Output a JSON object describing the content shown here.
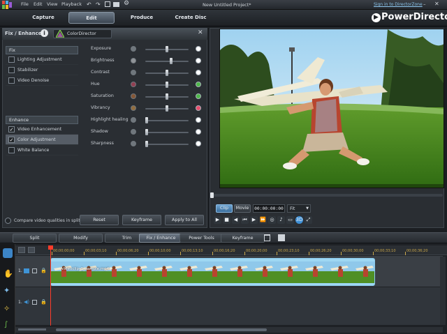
{
  "app": {
    "title": "New Untitled Project*",
    "brand": "PowerDirector",
    "link": "Sign in to DirectorZone"
  },
  "menu": [
    "File",
    "Edit",
    "View",
    "Playback"
  ],
  "main_tabs": [
    {
      "label": "Capture"
    },
    {
      "label": "Edit",
      "active": true
    },
    {
      "label": "Produce"
    },
    {
      "label": "Create Disc"
    }
  ],
  "panel": {
    "title": "Fix / Enhance",
    "logo_text": "ColorDirector",
    "fix": {
      "header": "Fix",
      "items": [
        {
          "label": "Lighting Adjustment",
          "checked": false
        },
        {
          "label": "Stabilizer",
          "checked": false
        },
        {
          "label": "Video Denoise",
          "checked": false
        }
      ]
    },
    "enhance": {
      "header": "Enhance",
      "items": [
        {
          "label": "Video Enhancement",
          "checked": true
        },
        {
          "label": "Color Adjustment",
          "checked": true,
          "selected": true
        },
        {
          "label": "White Balance",
          "checked": false
        }
      ]
    },
    "sliders": [
      {
        "label": "Exposure",
        "value": 0.5
      },
      {
        "label": "Brightness",
        "value": 0.6
      },
      {
        "label": "Contrast",
        "value": 0.5
      },
      {
        "label": "Hue",
        "value": 0.5
      },
      {
        "label": "Saturation",
        "value": 0.5
      },
      {
        "label": "Vibrancy",
        "value": 0.5
      },
      {
        "label": "Highlight healing",
        "value": 0.0
      },
      {
        "label": "Shadow",
        "value": 0.0
      },
      {
        "label": "Sharpness",
        "value": 0.0
      }
    ],
    "compare_label": "Compare video qualities in split pre...",
    "buttons": {
      "reset": "Reset",
      "keyframe": "Keyframe",
      "apply_all": "Apply to All"
    }
  },
  "preview": {
    "clip_label": "Clip",
    "movie_label": "Movie",
    "timecode": "00:00:00:00",
    "fit": "Fit"
  },
  "edit_tabs": [
    {
      "label": "Split"
    },
    {
      "label": "Modify"
    },
    {
      "label": "Trim"
    },
    {
      "label": "Fix / Enhance",
      "active": true
    },
    {
      "label": "Power Tools"
    },
    {
      "label": "Keyframe"
    }
  ],
  "timeline": {
    "ruler": [
      "00;00;00;00",
      "00;00;03;10",
      "00;00;06;20",
      "00;00;10;00",
      "00;00;13;10",
      "00;00;16;20",
      "00;00;20;00",
      "00;00;23;10",
      "00;00;26;20",
      "00;00;30;00",
      "00;00;33;10",
      "00;00;36;20"
    ],
    "tracks": [
      {
        "label": "1."
      },
      {
        "label": "1."
      }
    ],
    "clip_name": "Videoclip_1_sample.mp4"
  },
  "colors": {
    "accent": "#5aa2c8",
    "playhead": "#ff3c2a"
  }
}
